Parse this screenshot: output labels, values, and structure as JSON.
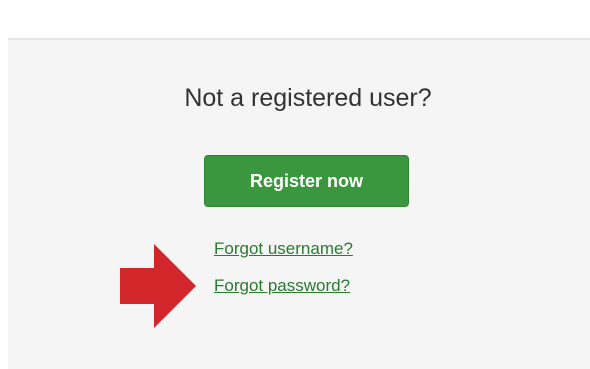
{
  "login_panel": {
    "heading": "Not a registered user?",
    "register_button_label": "Register now",
    "links": {
      "forgot_username": "Forgot username?",
      "forgot_password": "Forgot password?"
    }
  },
  "annotation": {
    "icon": "arrow-right-icon",
    "color": "#d3262a"
  },
  "colors": {
    "button_green": "#3b973e",
    "link_green": "#2a7a30",
    "panel_background": "#f5f5f5"
  }
}
